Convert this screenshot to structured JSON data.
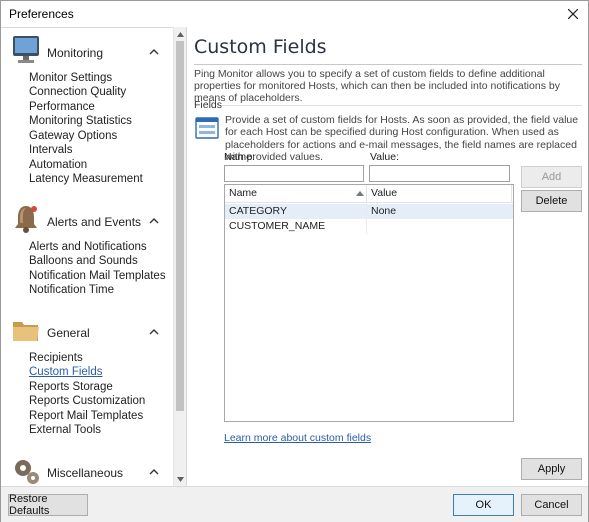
{
  "window": {
    "title": "Preferences"
  },
  "sidebar": {
    "groups": [
      {
        "title": "Monitoring",
        "items": [
          "Monitor Settings",
          "Connection Quality",
          "Performance",
          "Monitoring Statistics",
          "Gateway Options",
          "Intervals",
          "Automation",
          "Latency Measurement"
        ]
      },
      {
        "title": "Alerts and Events",
        "items": [
          "Alerts and Notifications",
          "Balloons and Sounds",
          "Notification Mail Templates",
          "Notification Time"
        ]
      },
      {
        "title": "General",
        "items": [
          "Recipients",
          "Custom Fields",
          "Reports Storage",
          "Reports Customization",
          "Report Mail Templates",
          "External Tools"
        ]
      },
      {
        "title": "Miscellaneous",
        "items": []
      }
    ],
    "active_item": "Custom Fields"
  },
  "main": {
    "title": "Custom Fields",
    "intro": "Ping Monitor allows you to specify a set of custom fields to define additional properties for monitored Hosts, which can then be included into notifications by means of placeholders.",
    "fields_label": "Fields",
    "fields_description": "Provide a set of custom fields for Hosts. As soon as provided, the field value for each Host can be specified during Host configuration. When used as placeholders for actions and e-mail messages, the field names are replaced with provided values.",
    "name_label": "Name:",
    "value_label": "Value:",
    "name_value": "",
    "value_value": "",
    "add_label": "Add",
    "delete_label": "Delete",
    "columns": {
      "name": "Name",
      "value": "Value"
    },
    "rows": [
      {
        "name": "CATEGORY",
        "value": "None"
      },
      {
        "name": "CUSTOMER_NAME",
        "value": ""
      }
    ],
    "learn_more": "Learn more about custom fields",
    "apply_label": "Apply"
  },
  "footer": {
    "restore_label": "Restore Defaults",
    "ok_label": "OK",
    "cancel_label": "Cancel"
  }
}
